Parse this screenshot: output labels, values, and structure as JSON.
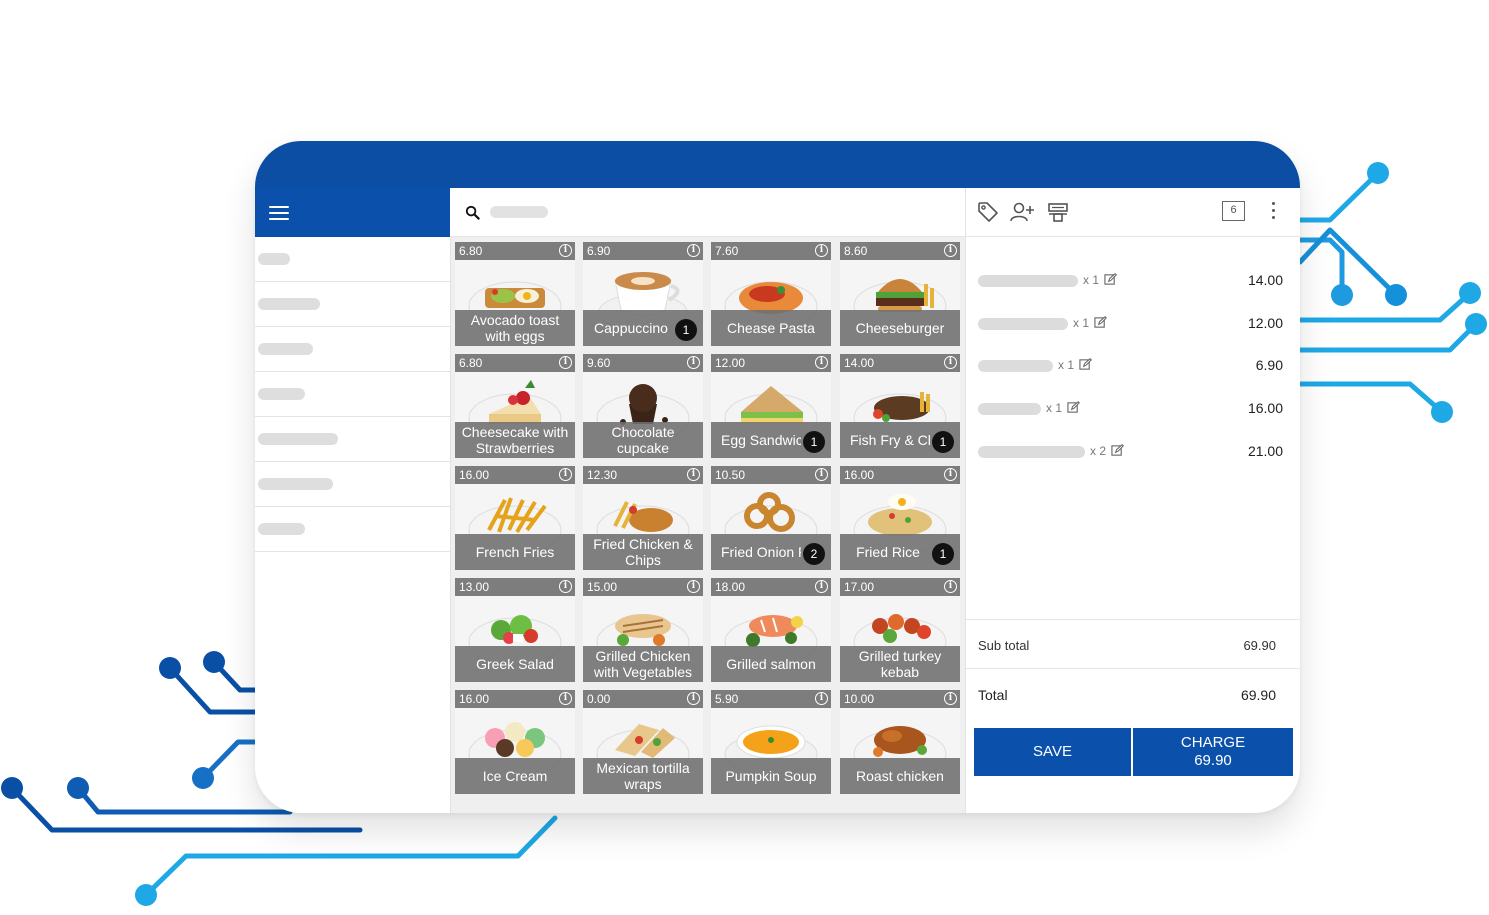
{
  "colors": {
    "brand": "#0b4ea3",
    "brand_button": "#0b51ab",
    "circuit_dark": "#0a4fa6",
    "circuit_light": "#1fa8e6"
  },
  "header": {
    "menu_icon": "hamburger-menu-icon",
    "search_icon": "search-icon"
  },
  "sidebar": {
    "items": [
      {
        "label": ""
      },
      {
        "label": ""
      },
      {
        "label": ""
      },
      {
        "label": ""
      },
      {
        "label": ""
      },
      {
        "label": ""
      },
      {
        "label": ""
      }
    ]
  },
  "products": [
    {
      "price": "6.80",
      "name": "Avocado toast with eggs",
      "qty": "",
      "image": "avocado-toast"
    },
    {
      "price": "6.90",
      "name": "Cappuccino",
      "qty": "1",
      "image": "cappuccino"
    },
    {
      "price": "7.60",
      "name": "Chease Pasta",
      "qty": "",
      "image": "pasta"
    },
    {
      "price": "8.60",
      "name": "Cheeseburger",
      "qty": "",
      "image": "burger"
    },
    {
      "price": "6.80",
      "name": "Cheesecake with Strawberries",
      "qty": "",
      "image": "cheesecake"
    },
    {
      "price": "9.60",
      "name": "Chocolate cupcake",
      "qty": "",
      "image": "cupcake"
    },
    {
      "price": "12.00",
      "name": "Egg Sandwich",
      "qty": "1",
      "image": "sandwich"
    },
    {
      "price": "14.00",
      "name": "Fish Fry & Chips",
      "qty": "1",
      "image": "fish"
    },
    {
      "price": "16.00",
      "name": "French Fries",
      "qty": "",
      "image": "fries"
    },
    {
      "price": "12.30",
      "name": "Fried Chicken & Chips",
      "qty": "",
      "image": "fried-chicken"
    },
    {
      "price": "10.50",
      "name": "Fried Onion Rings",
      "qty": "2",
      "image": "onion-rings"
    },
    {
      "price": "16.00",
      "name": "Fried Rice",
      "qty": "1",
      "image": "fried-rice"
    },
    {
      "price": "13.00",
      "name": "Greek Salad",
      "qty": "",
      "image": "salad"
    },
    {
      "price": "15.00",
      "name": "Grilled Chicken with Vegetables",
      "qty": "",
      "image": "grilled-chicken"
    },
    {
      "price": "18.00",
      "name": "Grilled salmon",
      "qty": "",
      "image": "salmon"
    },
    {
      "price": "17.00",
      "name": "Grilled turkey kebab",
      "qty": "",
      "image": "kebab"
    },
    {
      "price": "16.00",
      "name": "Ice Cream",
      "qty": "",
      "image": "ice-cream"
    },
    {
      "price": "0.00",
      "name": "Mexican tortilla wraps",
      "qty": "",
      "image": "tortilla"
    },
    {
      "price": "5.90",
      "name": "Pumpkin Soup",
      "qty": "",
      "image": "soup"
    },
    {
      "price": "10.00",
      "name": "Roast chicken",
      "qty": "",
      "image": "roast-chicken"
    }
  ],
  "cart": {
    "header_icons": [
      "tag-icon",
      "add-customer-icon",
      "printer-icon"
    ],
    "badge": "6",
    "lines": [
      {
        "qty": "x 1",
        "amount": "14.00"
      },
      {
        "qty": "x 1",
        "amount": "12.00"
      },
      {
        "qty": "x 1",
        "amount": "6.90"
      },
      {
        "qty": "x 1",
        "amount": "16.00"
      },
      {
        "qty": "x 2",
        "amount": "21.00"
      }
    ],
    "subtotal_label": "Sub total",
    "subtotal_value": "69.90",
    "total_label": "Total",
    "total_value": "69.90",
    "save_label": "SAVE",
    "charge_label": "CHARGE",
    "charge_amount": "69.90"
  }
}
